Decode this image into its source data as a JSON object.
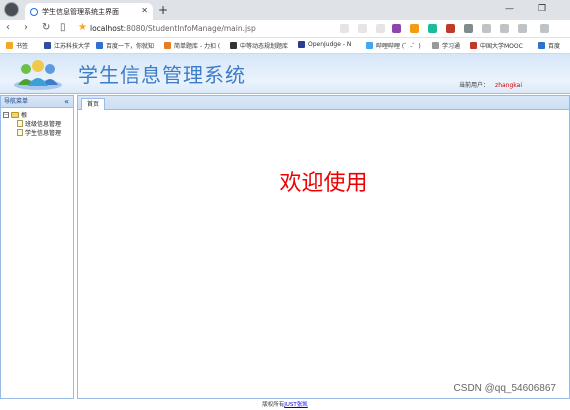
{
  "browser": {
    "tab_title": "学生信息管理系统主界面",
    "url_host": "localhost",
    "url_rest": ":8080/StudentInfoManage/main.jsp",
    "bookmarks": [
      "书签",
      "江苏科技大学",
      "百度一下，你就知",
      "简单题库 - 力扣 (",
      "中等动态规划题库",
      "OpenJudge - N",
      "哔哩哔哩 (゜-゜)",
      "学习通",
      "中国大学MOOC",
      "百度"
    ]
  },
  "header": {
    "title": "学生信息管理系统",
    "user_label": "当前用户：",
    "user_name": "zhangkai"
  },
  "sidebar": {
    "title": "导航菜单",
    "collapse_glyph": "«",
    "tree": {
      "root_label": "根",
      "items": [
        "班级信息管理",
        "学生信息管理"
      ]
    }
  },
  "main": {
    "tab_label": "首页",
    "welcome": "欢迎使用"
  },
  "footer": {
    "text": "版权所有",
    "link": "JUST张凯"
  },
  "watermark": "CSDN @qq_54606867"
}
